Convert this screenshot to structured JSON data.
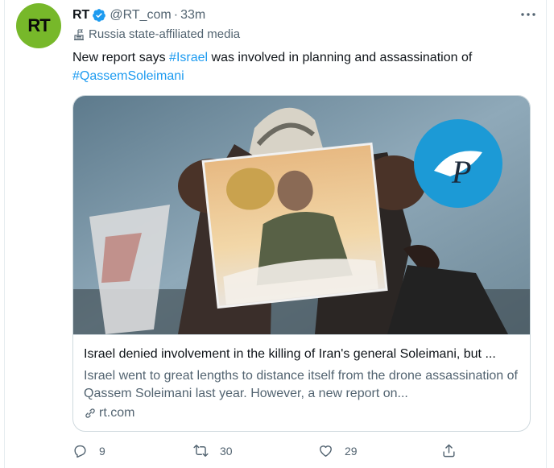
{
  "tweet": {
    "avatar_text": "RT",
    "display_name": "RT",
    "handle": "@RT_com",
    "separator": "·",
    "time": "33m",
    "label": "Russia state-affiliated media",
    "text_before": "New report says ",
    "hashtag_1": "#Israel",
    "text_middle": " was involved in planning and assassination of ",
    "hashtag_2": "#QassemSoleimani"
  },
  "card": {
    "title": "Israel denied involvement in the killing of Iran's general Soleimani, but ...",
    "description": "Israel went to great lengths to distance itself from the drone assassination of Qassem Soleimani last year. However, a new report on...",
    "domain": "rt.com"
  },
  "actions": {
    "reply_count": "9",
    "retweet_count": "30",
    "like_count": "29"
  },
  "colors": {
    "accent": "#1d9bf0",
    "avatar_bg": "#77b82a",
    "secondary_text": "#536471"
  }
}
